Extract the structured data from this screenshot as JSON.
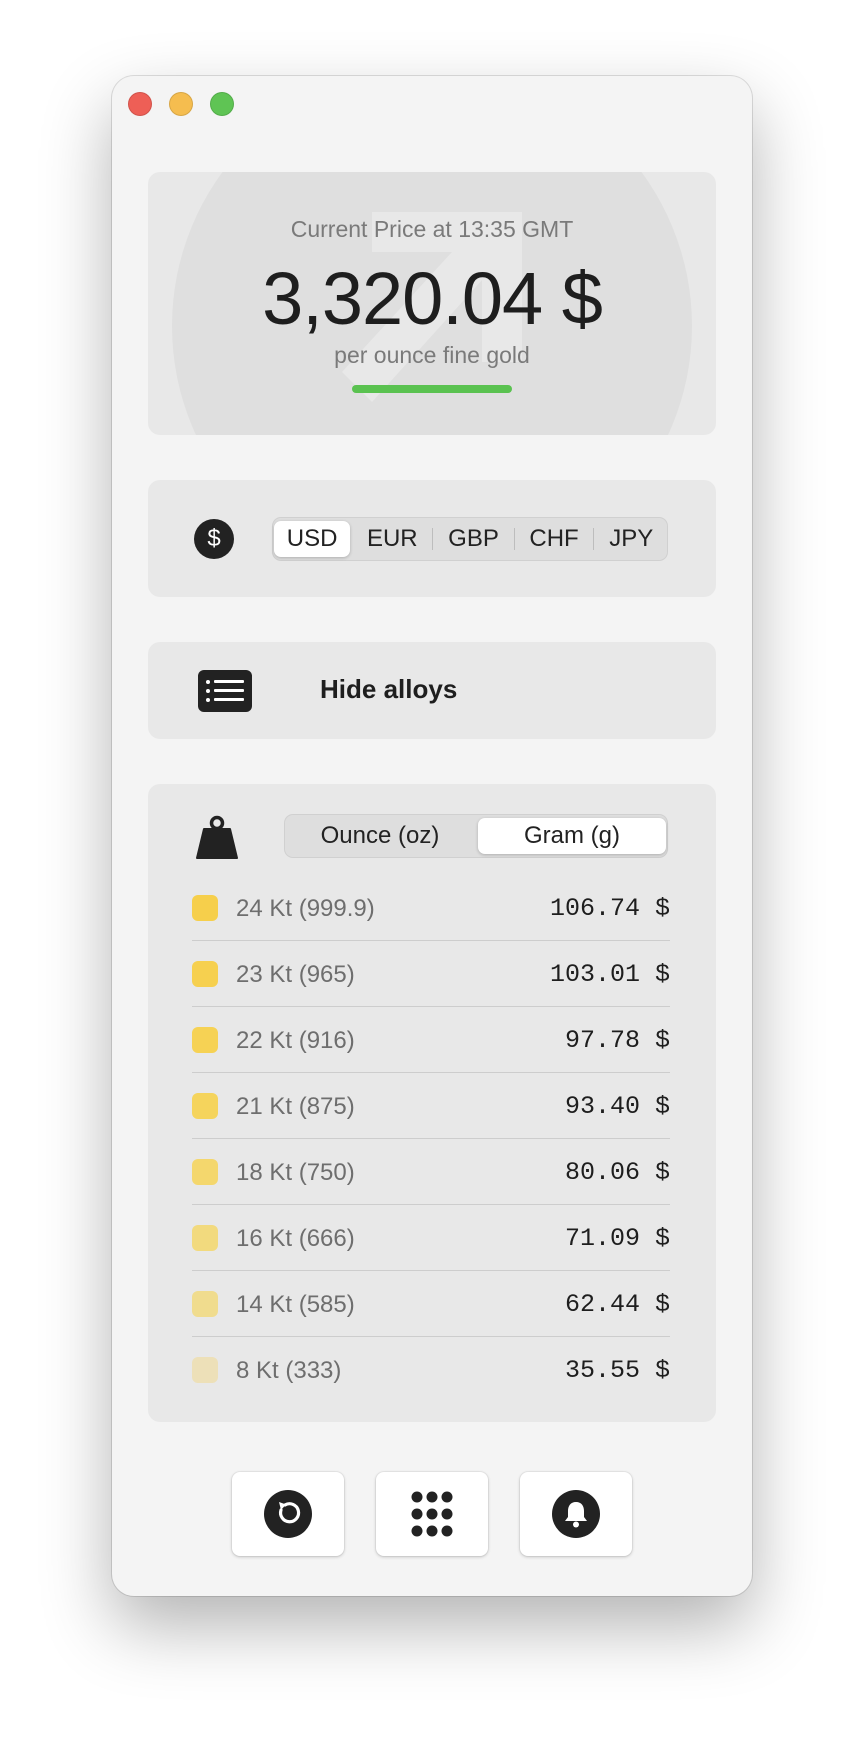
{
  "price": {
    "label": "Current Price at 13:35 GMT",
    "value": "3,320.04 $",
    "unit_caption": "per ounce fine gold",
    "trend": "up",
    "accent_color": "#5ac250"
  },
  "currency": {
    "icon": "dollar-circle-icon",
    "options": [
      "USD",
      "EUR",
      "GBP",
      "CHF",
      "JPY"
    ],
    "selected": "USD"
  },
  "alloys_toggle": {
    "icon": "list-icon",
    "label": "Hide alloys"
  },
  "unit": {
    "icon": "weight-icon",
    "options": [
      "Ounce (oz)",
      "Gram (g)"
    ],
    "selected": "Gram (g)"
  },
  "alloys": [
    {
      "name": "24 Kt (999.9)",
      "price": "106.74 $",
      "color": "#f6cf4b"
    },
    {
      "name": "23 Kt (965)",
      "price": "103.01 $",
      "color": "#f6d04f"
    },
    {
      "name": "22 Kt (916)",
      "price": "97.78 $",
      "color": "#f6d254"
    },
    {
      "name": "21 Kt (875)",
      "price": "93.40 $",
      "color": "#f5d45c"
    },
    {
      "name": "18 Kt (750)",
      "price": "80.06 $",
      "color": "#f4d76d"
    },
    {
      "name": "16 Kt (666)",
      "price": "71.09 $",
      "color": "#f2da7e"
    },
    {
      "name": "14 Kt (585)",
      "price": "62.44 $",
      "color": "#f0dc8e"
    },
    {
      "name": "8 Kt (333)",
      "price": "35.55 $",
      "color": "#ede0b8"
    }
  ],
  "toolbar": {
    "buttons": [
      "refresh-icon",
      "grid-icon",
      "bell-icon"
    ]
  }
}
